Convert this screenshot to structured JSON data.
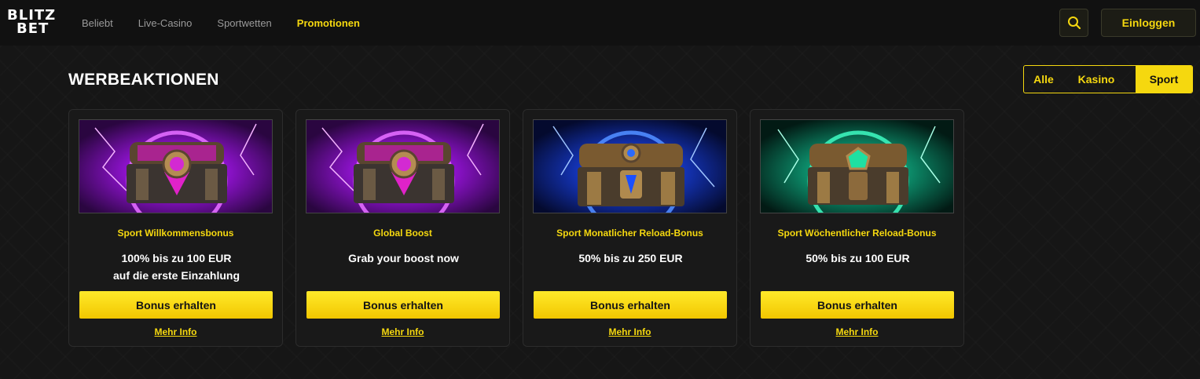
{
  "header": {
    "logo_line1": "BLITZ",
    "logo_line2": "BET",
    "nav": [
      "Beliebt",
      "Live-Casino",
      "Sportwetten",
      "Promotionen"
    ],
    "active_nav": "Promotionen",
    "login_label": "Einloggen",
    "search_icon": "search-icon"
  },
  "main": {
    "title": "WERBEAKTIONEN",
    "filters": [
      "Alle",
      "Kasino",
      "Sport"
    ],
    "active_filter": "Sport"
  },
  "cards": [
    {
      "title": "Sport Willkommensbonus",
      "desc_line1": "100% bis zu 100 EUR",
      "desc_line2": "auf die erste Einzahlung",
      "button": "Bonus erhalten",
      "link": "Mehr Info",
      "theme": "purple"
    },
    {
      "title": "Global Boost",
      "desc_line1": "Grab your boost now",
      "desc_line2": "",
      "button": "Bonus erhalten",
      "link": "Mehr Info",
      "theme": "purple"
    },
    {
      "title": "Sport Monatlicher Reload-Bonus",
      "desc_line1": "50% bis zu 250 EUR",
      "desc_line2": "",
      "button": "Bonus erhalten",
      "link": "Mehr Info",
      "theme": "blue"
    },
    {
      "title": "Sport Wöchentlicher Reload-Bonus",
      "desc_line1": "50% bis zu 100 EUR",
      "desc_line2": "",
      "button": "Bonus erhalten",
      "link": "Mehr Info",
      "theme": "green"
    }
  ],
  "colors": {
    "accent": "#f5d80f",
    "background": "#141414",
    "purple": "#b325e8",
    "blue": "#1e5bff",
    "green": "#16d69a"
  }
}
